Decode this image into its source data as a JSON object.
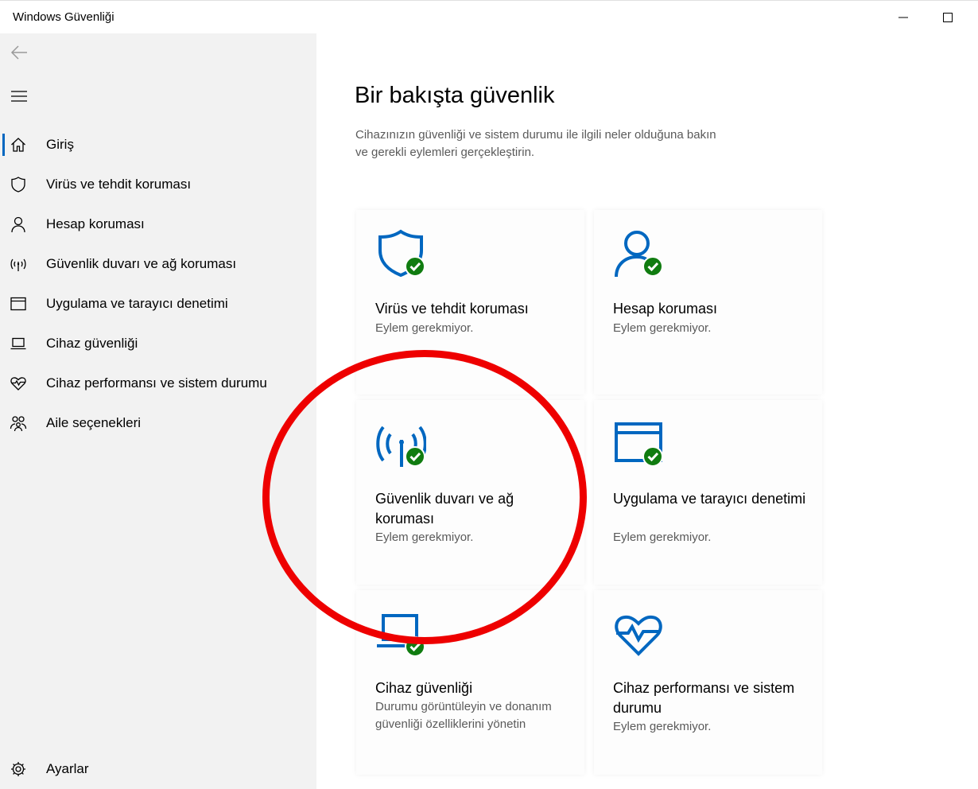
{
  "window": {
    "title": "Windows Güvenliği"
  },
  "sidebar": {
    "items": [
      {
        "label": "Giriş",
        "icon": "home-icon"
      },
      {
        "label": "Virüs ve tehdit koruması",
        "icon": "shield-icon"
      },
      {
        "label": "Hesap koruması",
        "icon": "person-icon"
      },
      {
        "label": "Güvenlik duvarı ve ağ koruması",
        "icon": "antenna-icon"
      },
      {
        "label": "Uygulama ve tarayıcı denetimi",
        "icon": "browser-window-icon"
      },
      {
        "label": "Cihaz güvenliği",
        "icon": "laptop-icon"
      },
      {
        "label": "Cihaz performansı ve sistem durumu",
        "icon": "heart-pulse-icon"
      },
      {
        "label": "Aile seçenekleri",
        "icon": "family-icon"
      }
    ],
    "settings_label": "Ayarlar"
  },
  "main": {
    "title": "Bir bakışta güvenlik",
    "description": "Cihazınızın güvenliği ve sistem durumu ile ilgili neler olduğuna bakın ve gerekli eylemleri gerçekleştirin.",
    "tiles": [
      {
        "title": "Virüs ve tehdit koruması",
        "status": "Eylem gerekmiyor.",
        "icon": "shield-icon"
      },
      {
        "title": "Hesap koruması",
        "status": "Eylem gerekmiyor.",
        "icon": "person-icon"
      },
      {
        "title": "Güvenlik duvarı ve ağ koruması",
        "status": "Eylem gerekmiyor.",
        "icon": "antenna-icon"
      },
      {
        "title": "Uygulama ve tarayıcı denetimi",
        "status": "Eylem gerekmiyor.",
        "icon": "browser-window-icon"
      },
      {
        "title": "Cihaz güvenliği",
        "status": "Durumu görüntüleyin ve donanım güvenliği özelliklerini yönetin",
        "icon": "laptop-icon"
      },
      {
        "title": "Cihaz performansı ve sistem durumu",
        "status": "Eylem gerekmiyor.",
        "icon": "heart-pulse-icon"
      }
    ]
  },
  "colors": {
    "accent": "#0067c0",
    "ok_badge": "#107c10",
    "annotation": "#ee0000",
    "sidebar_bg": "#f2f2f2"
  }
}
